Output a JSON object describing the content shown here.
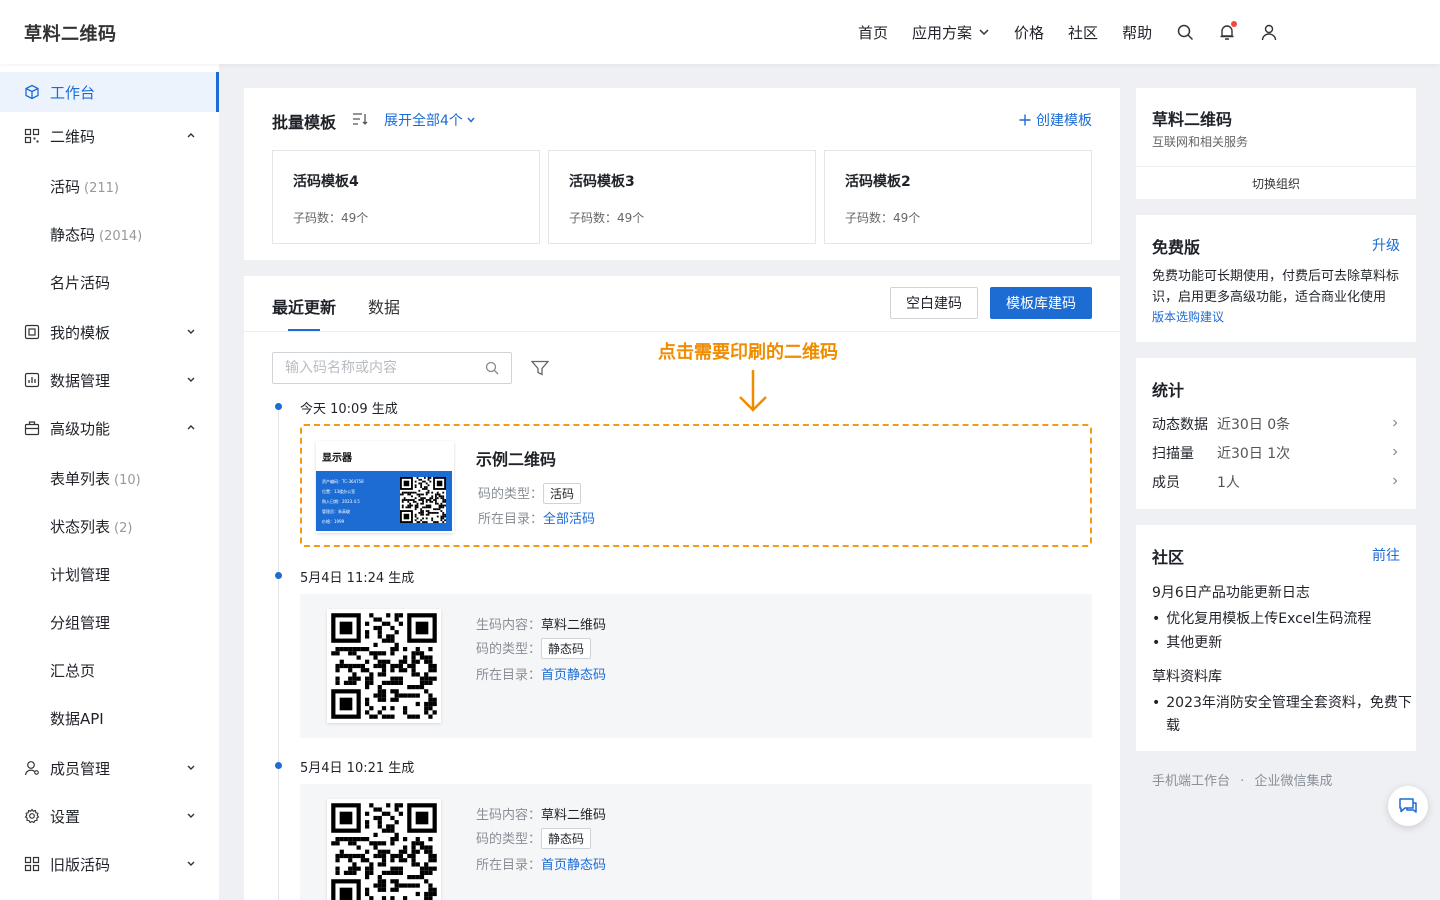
{
  "header": {
    "logo": "草料二维码",
    "nav": [
      "首页",
      "应用方案",
      "价格",
      "社区",
      "帮助"
    ]
  },
  "sidebar": {
    "items": [
      {
        "label": "工作台"
      },
      {
        "label": "二维码"
      },
      {
        "label": "活码",
        "count": "(211)"
      },
      {
        "label": "静态码",
        "count": "(2014)"
      },
      {
        "label": "名片活码"
      },
      {
        "label": "我的模板"
      },
      {
        "label": "数据管理"
      },
      {
        "label": "高级功能"
      },
      {
        "label": "表单列表",
        "count": "(10)"
      },
      {
        "label": "状态列表",
        "count": "(2)"
      },
      {
        "label": "计划管理"
      },
      {
        "label": "分组管理"
      },
      {
        "label": "汇总页"
      },
      {
        "label": "数据API"
      },
      {
        "label": "成员管理"
      },
      {
        "label": "设置"
      },
      {
        "label": "旧版活码"
      }
    ]
  },
  "templates": {
    "title": "批量模板",
    "expand": "展开全部4个",
    "create": "创建模板",
    "cards": [
      {
        "name": "活码模板4",
        "sub": "子码数：49个"
      },
      {
        "name": "活码模板3",
        "sub": "子码数：49个"
      },
      {
        "name": "活码模板2",
        "sub": "子码数：49个"
      }
    ]
  },
  "recent": {
    "tabs": [
      "最近更新",
      "数据"
    ],
    "blank_btn": "空白建码",
    "template_btn": "模板库建码",
    "search_placeholder": "输入码名称或内容",
    "annotation": "点击需要印刷的二维码",
    "entries": [
      {
        "time": "今天 10:09  生成",
        "name": "示例二维码",
        "type_label": "码的类型：",
        "type": "活码",
        "dir_label": "所在目录：",
        "dir": "全部活码",
        "label_thumb": {
          "title": "显示器",
          "lines": [
            "资产编码：TC-364758",
            "位置：13楼办公室",
            "购入日期：2023.4.5",
            "管理员：朱高峻",
            "价格：1999"
          ]
        }
      },
      {
        "time": "5月4日 11:24  生成",
        "content_label": "生码内容：",
        "content": "草料二维码",
        "type_label": "码的类型：",
        "type": "静态码",
        "dir_label": "所在目录：",
        "dir": "首页静态码"
      },
      {
        "time": "5月4日 10:21  生成",
        "content_label": "生码内容：",
        "content": "草料二维码",
        "type_label": "码的类型：",
        "type": "静态码",
        "dir_label": "所在目录：",
        "dir": "首页静态码"
      }
    ]
  },
  "org": {
    "name": "草料二维码",
    "industry": "互联网和相关服务",
    "switch": "切换组织"
  },
  "plan": {
    "title": "免费版",
    "upgrade": "升级",
    "desc_1": "免费功能可长期使用，付费后可去除草料标",
    "desc_2": "识，启用更多高级功能，适合商业化使用",
    "link": "版本选购建议"
  },
  "stats": {
    "title": "统计",
    "rows": [
      {
        "k": "动态数据",
        "v": "近30日  0条"
      },
      {
        "k": "扫描量",
        "v": "近30日  1次"
      },
      {
        "k": "成员",
        "v": "1人"
      }
    ]
  },
  "community": {
    "title": "社区",
    "go": "前往",
    "log_title": "9月6日产品功能更新日志",
    "log_items": [
      "优化复用模板上传Excel生码流程",
      "其他更新"
    ],
    "lib_title": "草料资料库",
    "lib_item_1": "2023年消防安全管理全套资料，免费下",
    "lib_item_2": "载"
  },
  "footer_links": {
    "mobile": "手机端工作台",
    "sep": "·",
    "wecom": "企业微信集成"
  },
  "colors": {
    "accent": "#1c6cd4",
    "highlight": "#f59a16"
  }
}
